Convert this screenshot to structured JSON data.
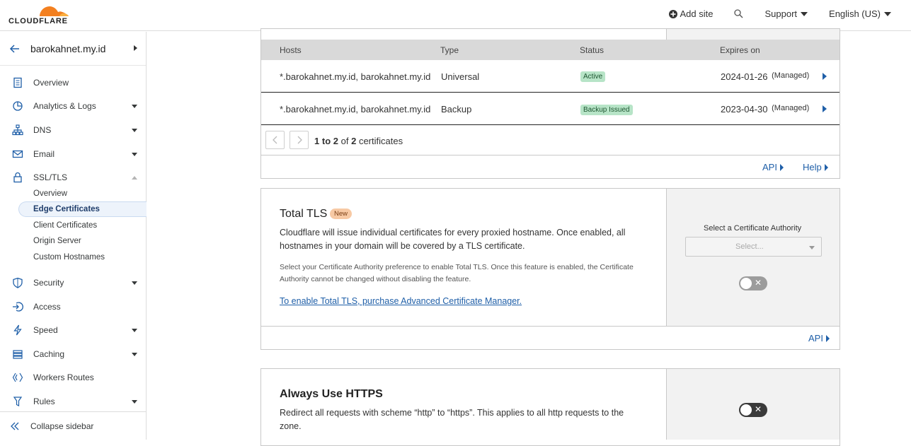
{
  "header": {
    "logo_text": "CLOUDFLARE",
    "add_site": "Add site",
    "support": "Support",
    "language": "English (US)"
  },
  "sidebar": {
    "site_name": "barokahnet.my.id",
    "items": [
      {
        "label": "Overview",
        "icon": "document-icon"
      },
      {
        "label": "Analytics & Logs",
        "icon": "chart-pie-icon"
      },
      {
        "label": "DNS",
        "icon": "network-icon"
      },
      {
        "label": "Email",
        "icon": "email-icon"
      },
      {
        "label": "SSL/TLS",
        "icon": "lock-icon"
      },
      {
        "label": "Security",
        "icon": "shield-icon"
      },
      {
        "label": "Access",
        "icon": "access-icon"
      },
      {
        "label": "Speed",
        "icon": "lightning-icon"
      },
      {
        "label": "Caching",
        "icon": "caching-icon"
      },
      {
        "label": "Workers Routes",
        "icon": "workers-icon"
      },
      {
        "label": "Rules",
        "icon": "rules-icon"
      }
    ],
    "ssl_sub": [
      "Overview",
      "Edge Certificates",
      "Client Certificates",
      "Origin Server",
      "Custom Hostnames"
    ],
    "collapse": "Collapse sidebar"
  },
  "certs": {
    "headers": [
      "Hosts",
      "Type",
      "Status",
      "Expires on"
    ],
    "rows": [
      {
        "hosts": "*.barokahnet.my.id, barokahnet.my.id",
        "type": "Universal",
        "status": "Active",
        "expires": "2024-01-26",
        "managed": "(Managed)"
      },
      {
        "hosts": "*.barokahnet.my.id, barokahnet.my.id",
        "type": "Backup",
        "status": "Backup Issued",
        "expires": "2023-04-30",
        "managed": "(Managed)"
      }
    ],
    "pager": {
      "from": "1",
      "to_word": "to",
      "to": "2",
      "of_word": "of",
      "total": "2",
      "suffix": "certificates"
    },
    "api": "API",
    "help": "Help"
  },
  "total_tls": {
    "title": "Total TLS",
    "badge": "New",
    "desc": "Cloudflare will issue individual certificates for every proxied hostname. Once enabled, all hostnames in your domain will be covered by a TLS certificate.",
    "note": "Select your Certificate Authority preference to enable Total TLS. Once this feature is enabled, the Certificate Authority cannot be changed without disabling the feature.",
    "link": "To enable Total TLS, purchase Advanced Certificate Manager.",
    "ca_label": "Select a Certificate Authority",
    "ca_placeholder": "Select...",
    "api": "API"
  },
  "https": {
    "title": "Always Use HTTPS",
    "desc": "Redirect all requests with scheme “http” to “https”. This applies to all http requests to the zone."
  },
  "colors": {
    "accent": "#1f5fa8",
    "active_badge": "#b7e4c7",
    "new_badge": "#f7c9a4",
    "logo_orange": "#f38020"
  }
}
